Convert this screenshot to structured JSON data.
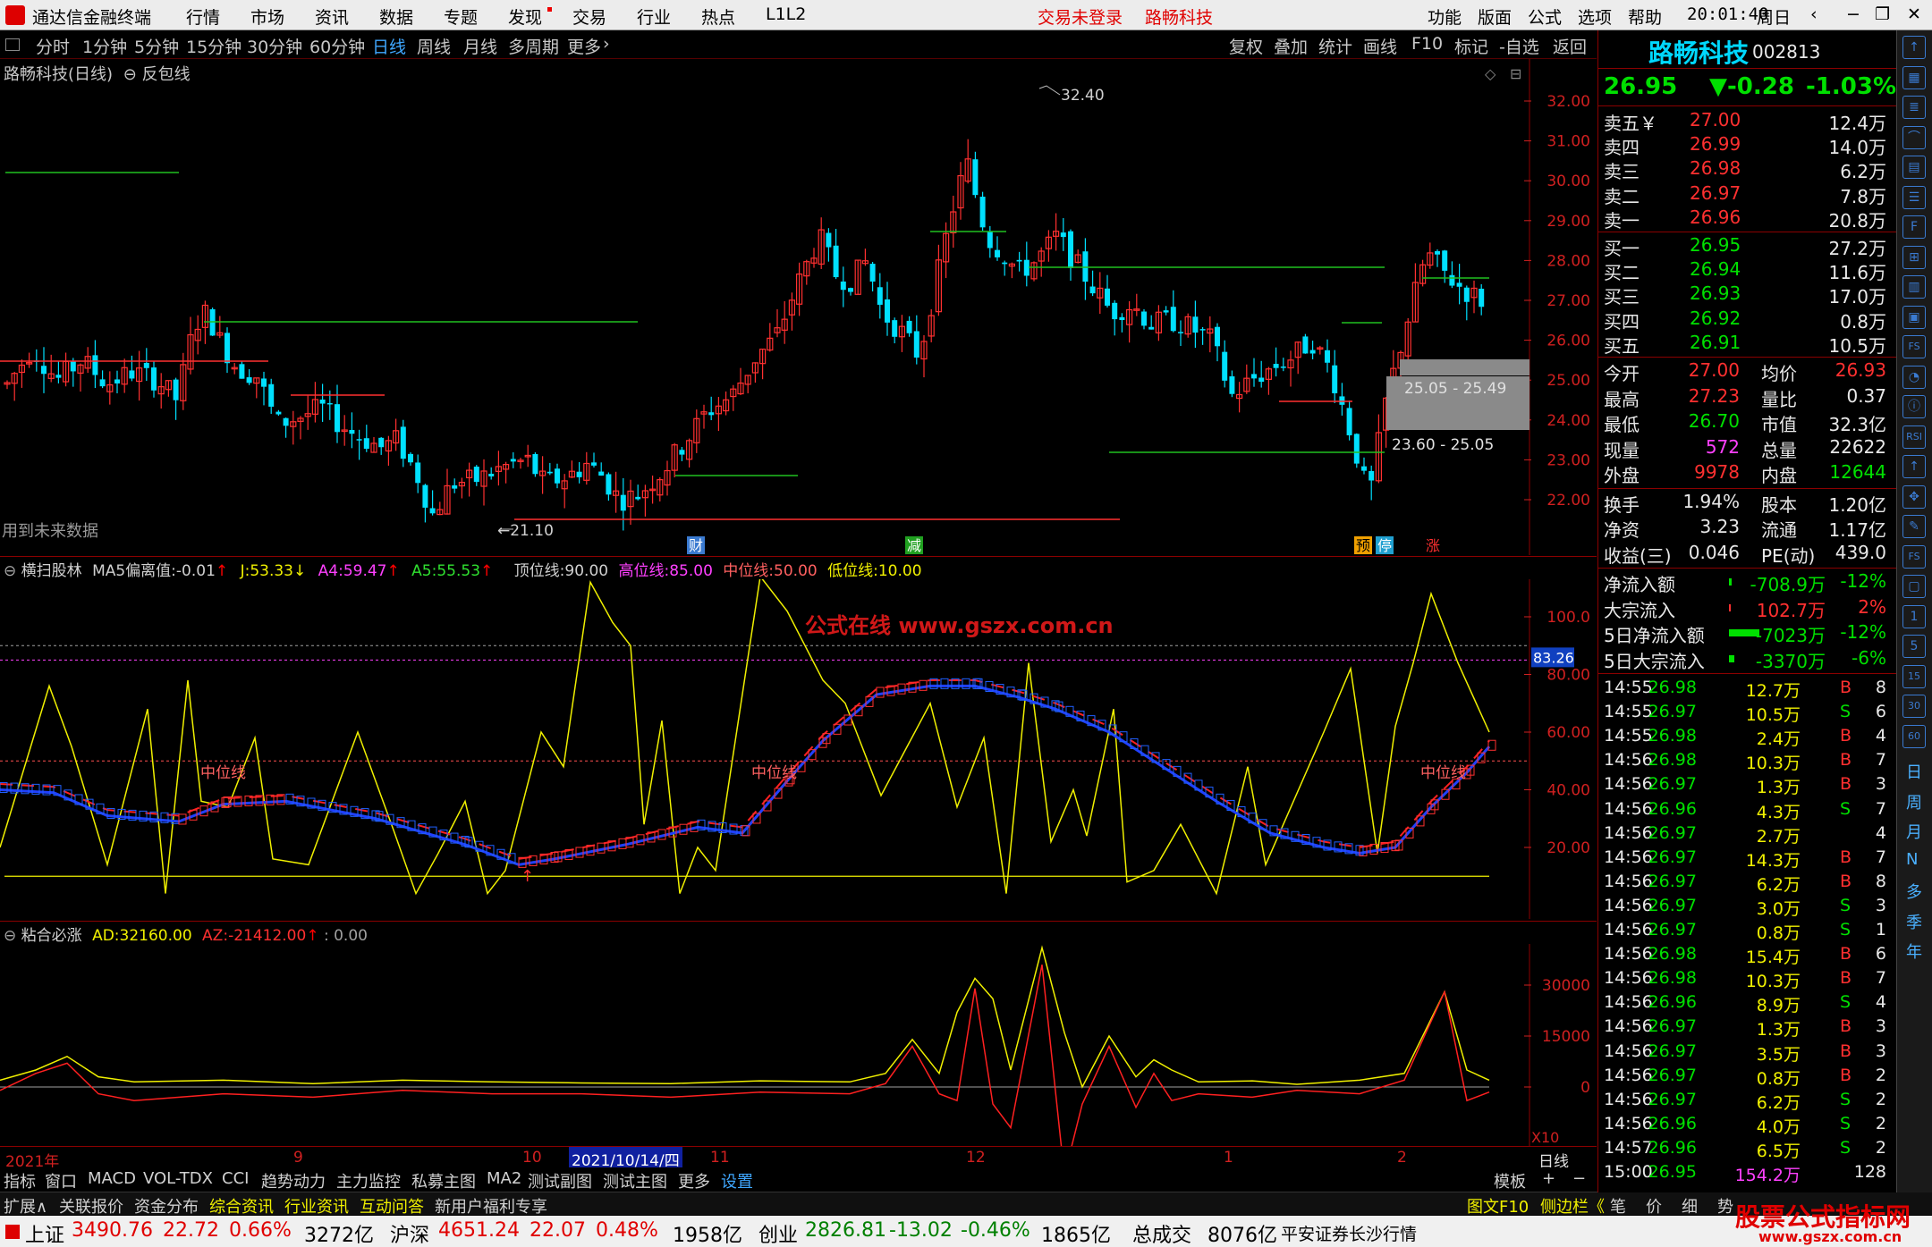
{
  "app": {
    "title": "通达信金融终端",
    "menu": [
      "行情",
      "市场",
      "资讯",
      "数据",
      "专题",
      "发现",
      "交易",
      "行业",
      "热点",
      "L1L2"
    ],
    "trade_status": "交易未登录",
    "stock_title": "路畅科技",
    "menu_right": [
      "功能",
      "版面",
      "公式",
      "选项",
      "帮助"
    ],
    "time": "20:01:40",
    "weekday": "周日"
  },
  "period_bar": {
    "periods": [
      "分时",
      "1分钟",
      "5分钟",
      "15分钟",
      "30分钟",
      "60分钟",
      "日线",
      "周线",
      "月线",
      "多周期",
      "更多"
    ],
    "active": "日线",
    "tools": [
      "复权",
      "叠加",
      "统计",
      "画线",
      "F10",
      "标记",
      "-自选",
      "返回"
    ]
  },
  "main_chart": {
    "header_name": "路畅科技(日线)",
    "header_formula": "反包线",
    "future_label": "用到未来数据",
    "high_label": "32.40",
    "low_label": "21.10",
    "box1_label": "25.05 - 25.49",
    "box2_label": "23.60 - 25.05",
    "event_marks": [
      "财",
      "减",
      "预",
      "停",
      "涨"
    ],
    "y_ticks": [
      "32.00",
      "31.00",
      "30.00",
      "29.00",
      "28.00",
      "27.00",
      "26.00",
      "25.00",
      "24.00",
      "23.00",
      "22.00"
    ]
  },
  "indicator1": {
    "name": "横扫股林",
    "items": [
      {
        "label": "MA5偏离值:",
        "value": "-0.01",
        "arrow": "↑"
      },
      {
        "label": "J:",
        "value": "53.33",
        "arrow": "↓"
      },
      {
        "label": "A4:",
        "value": "59.47",
        "arrow": "↑"
      },
      {
        "label": "A5:",
        "value": "55.53",
        "arrow": "↑"
      },
      {
        "label": "顶位线:",
        "value": "90.00"
      },
      {
        "label": "高位线:",
        "value": "85.00"
      },
      {
        "label": "中位线:",
        "value": "50.00"
      },
      {
        "label": "低位线:",
        "value": "10.00"
      }
    ],
    "watermark": "公式在线  www.gszx.com.cn",
    "mid_label": "中位线",
    "current_value": "83.26",
    "y_ticks": [
      "100.0",
      "80.00",
      "60.00",
      "40.00",
      "20.00"
    ]
  },
  "indicator2": {
    "name": "粘合必涨",
    "ad_label": "AD:",
    "ad_value": "32160.00",
    "az_label": "AZ:",
    "az_value": "-21412.00",
    "extra": ": 0.00",
    "y_ticks": [
      "30000",
      "15000",
      "0"
    ],
    "x10": "X10"
  },
  "x_axis": {
    "labels": [
      "2021年",
      "9",
      "10",
      "2021/10/14/四",
      "11",
      "12",
      "1",
      "2"
    ],
    "right": "日线"
  },
  "tabs": {
    "items": [
      "指标",
      "窗口",
      "MACD",
      "VOL-TDX",
      "CCI",
      "趋势动力",
      "主力监控",
      "私募主图",
      "MA2",
      "测试副图",
      "测试主图",
      "更多",
      "设置"
    ],
    "right": [
      "模板",
      "+",
      "−"
    ]
  },
  "info_bar": {
    "items": [
      "扩展∧",
      "关联报价",
      "资金分布",
      "综合资讯",
      "行业资讯",
      "互动问答",
      "新用户福利专享"
    ],
    "right": [
      "图文F10",
      "侧边栏《",
      "笔",
      "价",
      "细",
      "势"
    ]
  },
  "quote": {
    "name": "路畅科技",
    "code": "002813",
    "price": "26.95",
    "change": "▼-0.28",
    "pct": "-1.03%",
    "asks": [
      {
        "label": "卖五￥",
        "price": "27.00",
        "vol": "12.4万"
      },
      {
        "label": "卖四",
        "price": "26.99",
        "vol": "14.0万"
      },
      {
        "label": "卖三",
        "price": "26.98",
        "vol": "6.2万"
      },
      {
        "label": "卖二",
        "price": "26.97",
        "vol": "7.8万"
      },
      {
        "label": "卖一",
        "price": "26.96",
        "vol": "20.8万"
      }
    ],
    "bids": [
      {
        "label": "买一",
        "price": "26.95",
        "vol": "27.2万"
      },
      {
        "label": "买二",
        "price": "26.94",
        "vol": "11.6万"
      },
      {
        "label": "买三",
        "price": "26.93",
        "vol": "17.0万"
      },
      {
        "label": "买四",
        "price": "26.92",
        "vol": "0.8万"
      },
      {
        "label": "买五",
        "price": "26.91",
        "vol": "10.5万"
      }
    ],
    "stats": [
      {
        "l1": "今开",
        "v1": "27.00",
        "l2": "均价",
        "v2": "26.93"
      },
      {
        "l1": "最高",
        "v1": "27.23",
        "l2": "量比",
        "v2": "0.37"
      },
      {
        "l1": "最低",
        "v1": "26.70",
        "l2": "市值",
        "v2": "32.3亿"
      },
      {
        "l1": "现量",
        "v1": "572",
        "l2": "总量",
        "v2": "22622"
      },
      {
        "l1": "外盘",
        "v1": "9978",
        "l2": "内盘",
        "v2": "12644"
      }
    ],
    "stats2": [
      {
        "l1": "换手",
        "v1": "1.94%",
        "l2": "股本",
        "v2": "1.20亿"
      },
      {
        "l1": "净资",
        "v1": "3.23",
        "l2": "流通",
        "v2": "1.17亿"
      },
      {
        "l1": "收益(三)",
        "v1": "0.046",
        "l2": "PE(动)",
        "v2": "439.0"
      }
    ],
    "flows": [
      {
        "label": "净流入额",
        "value": "-708.9万",
        "pct": "-12%"
      },
      {
        "label": "大宗流入",
        "value": "102.7万",
        "pct": "2%"
      },
      {
        "label": "5日净流入额",
        "value": "-7023万",
        "pct": "-12%"
      },
      {
        "label": "5日大宗流入",
        "value": "-3370万",
        "pct": "-6%"
      }
    ],
    "ticks": [
      {
        "t": "14:55",
        "p": "26.98",
        "v": "12.7万",
        "s": "B",
        "n": "8"
      },
      {
        "t": "14:55",
        "p": "26.97",
        "v": "10.5万",
        "s": "S",
        "n": "6"
      },
      {
        "t": "14:55",
        "p": "26.98",
        "v": "2.4万",
        "s": "B",
        "n": "4"
      },
      {
        "t": "14:56",
        "p": "26.98",
        "v": "10.3万",
        "s": "B",
        "n": "7"
      },
      {
        "t": "14:56",
        "p": "26.97",
        "v": "1.3万",
        "s": "B",
        "n": "3"
      },
      {
        "t": "14:56",
        "p": "26.96",
        "v": "4.3万",
        "s": "S",
        "n": "7"
      },
      {
        "t": "14:56",
        "p": "26.97",
        "v": "2.7万",
        "s": "",
        "n": "4"
      },
      {
        "t": "14:56",
        "p": "26.97",
        "v": "14.3万",
        "s": "B",
        "n": "7"
      },
      {
        "t": "14:56",
        "p": "26.97",
        "v": "6.2万",
        "s": "B",
        "n": "8"
      },
      {
        "t": "14:56",
        "p": "26.97",
        "v": "3.0万",
        "s": "S",
        "n": "3"
      },
      {
        "t": "14:56",
        "p": "26.97",
        "v": "0.8万",
        "s": "S",
        "n": "1"
      },
      {
        "t": "14:56",
        "p": "26.98",
        "v": "15.4万",
        "s": "B",
        "n": "6"
      },
      {
        "t": "14:56",
        "p": "26.98",
        "v": "10.3万",
        "s": "B",
        "n": "7"
      },
      {
        "t": "14:56",
        "p": "26.96",
        "v": "8.9万",
        "s": "S",
        "n": "4"
      },
      {
        "t": "14:56",
        "p": "26.97",
        "v": "1.3万",
        "s": "B",
        "n": "3"
      },
      {
        "t": "14:56",
        "p": "26.97",
        "v": "3.5万",
        "s": "B",
        "n": "3"
      },
      {
        "t": "14:56",
        "p": "26.97",
        "v": "0.8万",
        "s": "B",
        "n": "2"
      },
      {
        "t": "14:56",
        "p": "26.97",
        "v": "6.2万",
        "s": "S",
        "n": "2"
      },
      {
        "t": "14:56",
        "p": "26.96",
        "v": "4.0万",
        "s": "S",
        "n": "2"
      },
      {
        "t": "14:57",
        "p": "26.96",
        "v": "6.5万",
        "s": "S",
        "n": "2"
      },
      {
        "t": "15:00",
        "p": "26.95",
        "v": "154.2万",
        "s": "",
        "n": "128"
      }
    ]
  },
  "side_icons": [
    "日",
    "周",
    "月",
    "N",
    "多",
    "季",
    "年"
  ],
  "status_bar": {
    "items": [
      {
        "name": "上证",
        "price": "3490.76",
        "chg": "22.72",
        "pct": "0.66%",
        "amt": "3272亿"
      },
      {
        "name": "沪深",
        "price": "4651.24",
        "chg": "22.07",
        "pct": "0.48%",
        "amt": "1958亿"
      },
      {
        "name": "创业",
        "price": "2826.81",
        "chg": "-13.02",
        "pct": "-0.46%",
        "amt": "1865亿"
      }
    ],
    "total_label": "总成交",
    "total": "8076亿",
    "broker": "平安证券长沙行情",
    "logo_text": "股票公式指标网",
    "logo_url": "www.gszx.com.cn"
  }
}
